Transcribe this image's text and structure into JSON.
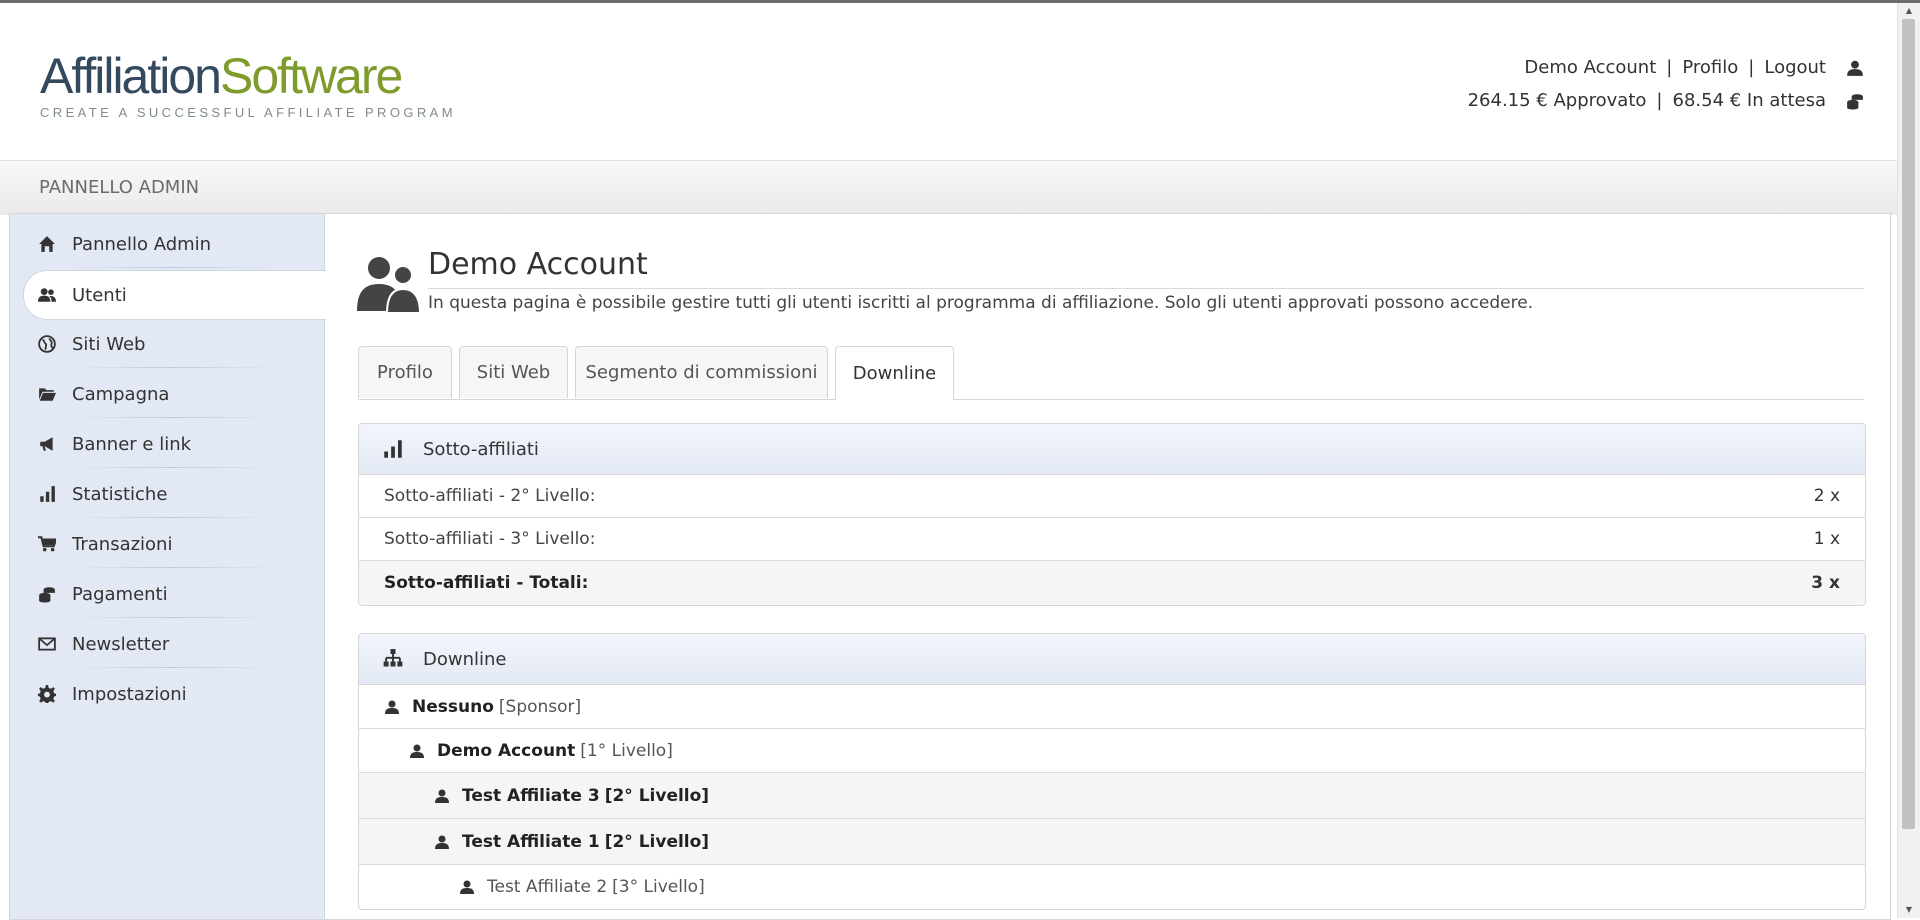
{
  "app": {
    "logo_part1": "Affiliation",
    "logo_part2": "Software",
    "logo_tagline": "CREATE A SUCCESSFUL AFFILIATE PROGRAM",
    "colors": {
      "logo_dark": "#34495e",
      "logo_green": "#7d9c2c",
      "sidebar_bg": "#e2e8f4"
    }
  },
  "user_menu": {
    "account": "Demo Account",
    "profile": "Profilo",
    "logout": "Logout",
    "balance_approved": "264.15 € Approvato",
    "balance_pending": "68.54 € In attesa",
    "icons": [
      "user-icon",
      "coins-icon"
    ]
  },
  "admin_bar": {
    "title": "PANNELLO ADMIN"
  },
  "sidebar": {
    "items": [
      {
        "label": "Pannello Admin",
        "icon": "home-icon",
        "active": false
      },
      {
        "label": "Utenti",
        "icon": "users-icon",
        "active": true
      },
      {
        "label": "Siti Web",
        "icon": "globe-icon",
        "active": false
      },
      {
        "label": "Campagna",
        "icon": "folder-icon",
        "active": false
      },
      {
        "label": "Banner e link",
        "icon": "megaphone-icon",
        "active": false
      },
      {
        "label": "Statistiche",
        "icon": "bar-chart-icon",
        "active": false
      },
      {
        "label": "Transazioni",
        "icon": "cart-icon",
        "active": false
      },
      {
        "label": "Pagamenti",
        "icon": "coins-icon",
        "active": false
      },
      {
        "label": "Newsletter",
        "icon": "envelope-icon",
        "active": false
      },
      {
        "label": "Impostazioni",
        "icon": "gear-icon",
        "active": false
      }
    ]
  },
  "page": {
    "title": "Demo Account",
    "description": "In questa pagina è possibile gestire tutti gli utenti iscritti al programma di affiliazione. Solo gli utenti approvati possono accedere."
  },
  "tabs": [
    {
      "label": "Profilo",
      "active": false
    },
    {
      "label": "Siti Web",
      "active": false
    },
    {
      "label": "Segmento di commissioni",
      "active": false
    },
    {
      "label": "Downline",
      "active": true
    }
  ],
  "sub_affiliates": {
    "title": "Sotto-affiliati",
    "rows": [
      {
        "label": "Sotto-affiliati - 2° Livello:",
        "value": "2 x"
      },
      {
        "label": "Sotto-affiliati - 3° Livello:",
        "value": "1 x"
      }
    ],
    "total": {
      "label": "Sotto-affiliati - Totali:",
      "value": "3 x"
    }
  },
  "downline": {
    "title": "Downline",
    "rows": [
      {
        "name": "Nessuno",
        "level": "[Sponsor]"
      },
      {
        "name": "Demo Account",
        "level": "[1° Livello]"
      },
      {
        "name": "Test Affiliate 3",
        "level": "[2° Livello]"
      },
      {
        "name": "Test Affiliate 1",
        "level": "[2° Livello]"
      },
      {
        "name": "Test Affiliate 2",
        "level": "[3° Livello]"
      }
    ]
  }
}
